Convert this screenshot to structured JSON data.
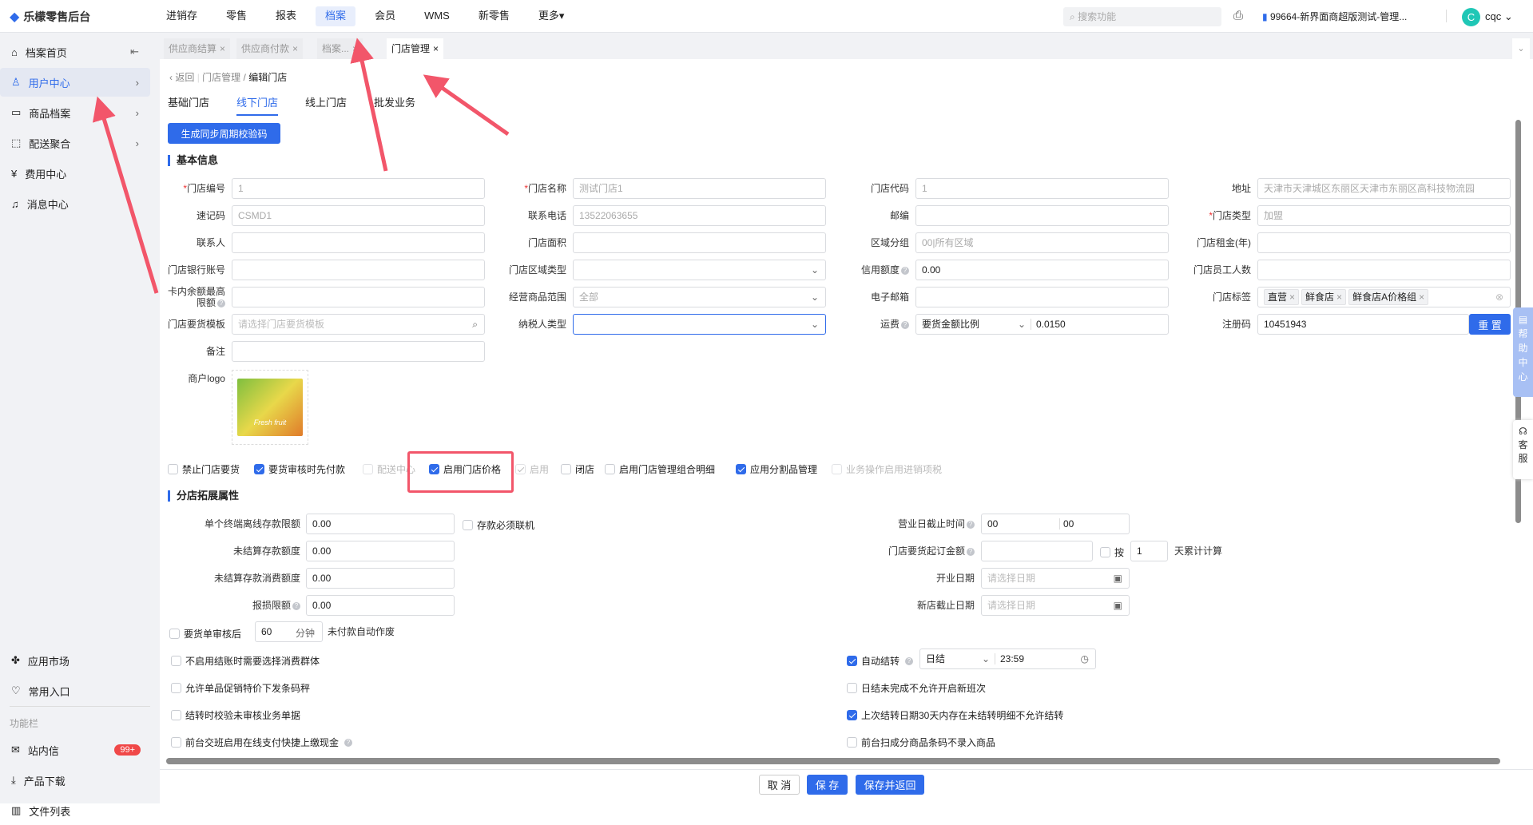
{
  "app": {
    "title": "乐檬零售后台"
  },
  "nav": [
    "进销存",
    "零售",
    "报表",
    "档案",
    "会员",
    "WMS",
    "新零售",
    "更多▾"
  ],
  "nav_active": 3,
  "header": {
    "search_placeholder": "搜索功能",
    "store": "99664-新界面商超版测试-管理...",
    "avatar_letter": "C",
    "user": "cqc"
  },
  "sidebar": {
    "items": [
      {
        "label": "档案首页",
        "icon": "home-icon"
      },
      {
        "label": "用户中心",
        "icon": "user-icon",
        "active": true
      },
      {
        "label": "商品档案",
        "icon": "goods-icon"
      },
      {
        "label": "配送聚合",
        "icon": "delivery-icon"
      },
      {
        "label": "费用中心",
        "icon": "fee-icon"
      },
      {
        "label": "消息中心",
        "icon": "bell-icon"
      }
    ],
    "bottom": [
      {
        "label": "应用市场",
        "icon": "app-market-icon"
      },
      {
        "label": "常用入口",
        "icon": "heart-icon"
      }
    ],
    "section_label": "功能栏",
    "tools": [
      {
        "label": "站内信",
        "icon": "mail-icon",
        "badge": "99+"
      },
      {
        "label": "产品下载",
        "icon": "download-icon"
      },
      {
        "label": "文件列表",
        "icon": "file-list-icon"
      }
    ]
  },
  "tabs": [
    {
      "label": "供应商结算"
    },
    {
      "label": "供应商付款"
    },
    {
      "label": "档案..."
    },
    {
      "label": "门店管理",
      "active": true
    }
  ],
  "breadcrumb": {
    "back": "返回",
    "parent": "门店管理",
    "current": "编辑门店"
  },
  "subtabs": [
    "基础门店",
    "线下门店",
    "线上门店",
    "批发业务"
  ],
  "subtab_active": 1,
  "generate_button": "生成同步周期校验码",
  "basic": {
    "title": "基本信息",
    "rows": [
      [
        {
          "label": "门店编号",
          "req": true,
          "value": "1",
          "dis": true
        },
        {
          "label": "门店名称",
          "req": true,
          "value": "测试门店1",
          "dis": true
        },
        {
          "label": "门店代码",
          "value": "1",
          "dis": true
        },
        {
          "label": "地址",
          "value": "天津市天津城区东丽区天津市东丽区高科技物流园",
          "dis": true
        }
      ],
      [
        {
          "label": "速记码",
          "value": "CSMD1",
          "dis": true
        },
        {
          "label": "联系电话",
          "value": "13522063655",
          "dis": true
        },
        {
          "label": "邮编",
          "value": ""
        },
        {
          "label": "门店类型",
          "req": true,
          "value": "加盟",
          "dis": true
        }
      ],
      [
        {
          "label": "联系人",
          "value": ""
        },
        {
          "label": "门店面积",
          "value": ""
        },
        {
          "label": "区域分组",
          "value": "00|所有区域",
          "dis": true
        },
        {
          "label": "门店租金(年)",
          "value": ""
        }
      ],
      [
        {
          "label": "门店银行账号",
          "value": ""
        },
        {
          "label": "门店区域类型",
          "value": "",
          "type": "select"
        },
        {
          "label": "信用额度",
          "help": true,
          "value": "0.00"
        },
        {
          "label": "门店员工人数",
          "value": ""
        }
      ],
      [
        {
          "label": "卡内余额最高限额",
          "help": true,
          "value": ""
        },
        {
          "label": "经营商品范围",
          "value": "全部",
          "dis": true,
          "type": "select"
        },
        {
          "label": "电子邮箱",
          "value": ""
        },
        {
          "label": "门店标签",
          "type": "tags",
          "tags": [
            "直营",
            "鲜食店",
            "鲜食店A价格组"
          ]
        }
      ],
      [
        {
          "label": "门店要货模板",
          "placeholder": "请选择门店要货模板",
          "type": "search"
        },
        {
          "label": "纳税人类型",
          "value": "",
          "type": "select",
          "focus": true
        },
        {
          "label": "运费",
          "help": true,
          "type": "freight",
          "mode": "要货金额比例",
          "value": "0.0150"
        },
        {
          "label": "注册码",
          "type": "reg",
          "value": "10451943",
          "button": "重 置"
        }
      ],
      [
        {
          "label": "备注",
          "value": ""
        },
        null,
        null,
        null
      ]
    ],
    "logo_label": "商户logo",
    "logo_text": "Fresh fruit"
  },
  "options": [
    {
      "label": "禁止门店要货",
      "on": false
    },
    {
      "label": "要货审核时先付款",
      "on": true
    },
    {
      "label": "配送中心",
      "on": false,
      "dis": true
    },
    {
      "label": "启用门店价格",
      "on": true
    },
    {
      "label": "启用",
      "on": true,
      "dis": true
    },
    {
      "label": "闭店",
      "on": false
    },
    {
      "label": "启用门店管理组合明细",
      "on": false
    },
    {
      "label": "应用分割品管理",
      "on": true
    },
    {
      "label": "业务操作启用进销项税",
      "on": false,
      "dis": true
    }
  ],
  "ext": {
    "title": "分店拓展属性",
    "left": [
      {
        "label": "单个终端离线存款限额",
        "value": "0.00"
      },
      {
        "label": "未结算存款额度",
        "value": "0.00"
      },
      {
        "label": "未结算存款消费额度",
        "value": "0.00"
      },
      {
        "label": "报损限额",
        "value": "0.00",
        "help": true
      }
    ],
    "online_required": "存款必须联机",
    "cutoff": {
      "label": "营业日截止时间",
      "h": "00",
      "m": "00"
    },
    "min_order": {
      "label": "门店要货起订金额",
      "value": "",
      "by": "按",
      "days": "1",
      "suffix": "天累计计算"
    },
    "open_date": {
      "label": "开业日期",
      "placeholder": "请选择日期"
    },
    "new_end_date": {
      "label": "新店截止日期",
      "placeholder": "请选择日期"
    },
    "audit": {
      "label": "要货单审核后",
      "minutes": "60",
      "unit": "分钟",
      "suffix": "未付款自动作废"
    },
    "checks_left": [
      {
        "label": "不启用结账时需要选择消费群体",
        "on": false
      },
      {
        "label": "允许单品促销特价下发条码秤",
        "on": false
      },
      {
        "label": "结转时校验未审核业务单据",
        "on": false
      },
      {
        "label": "前台交班启用在线支付快捷上缴现金",
        "on": false,
        "help": true
      }
    ],
    "auto": {
      "label": "自动结转",
      "on": true,
      "mode": "日结",
      "time": "23:59"
    },
    "checks_right": [
      {
        "label": "日结未完成不允许开启新班次",
        "on": false
      },
      {
        "label": "上次结转日期30天内存在未结转明细不允许结转",
        "on": true
      },
      {
        "label": "前台扫成分商品条码不录入商品",
        "on": false
      }
    ]
  },
  "footer": {
    "cancel": "取 消",
    "save": "保 存",
    "save_return": "保存并返回"
  },
  "float": {
    "help": "帮助中心",
    "service": "客服"
  },
  "colors": {
    "accent": "#2f6bea",
    "annotation": "#f2566a"
  }
}
